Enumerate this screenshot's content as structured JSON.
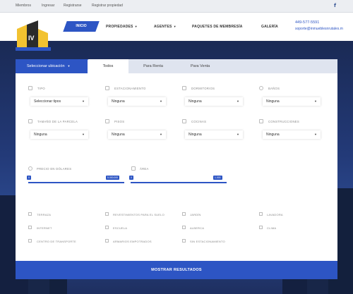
{
  "topbar": {
    "links": [
      "Miembros",
      "Ingresar",
      "Registrarse",
      "Registrar propiedad"
    ],
    "facebook_icon": "facebook-icon"
  },
  "header": {
    "nav": {
      "home": "INICIO",
      "properties": "PROPIEDADES",
      "agents": "AGENTES",
      "membership": "PAQUETES DE MEMBRESÍA",
      "gallery": "GALERÍA"
    },
    "phone": "449-577-5591",
    "email": "soporte@inmueblesnrutales.m"
  },
  "search": {
    "tabs": {
      "select_location": "Seleccionar ubicación",
      "all": "Todos",
      "rent": "Para Renta",
      "sale": "Para Venta"
    },
    "fields": [
      {
        "label": "TIPO",
        "value": "Seleccionar tipos"
      },
      {
        "label": "ESTACIONAMIENTO",
        "value": "Ninguna"
      },
      {
        "label": "DORMITORIOS",
        "value": "Ninguna"
      },
      {
        "label": "BAÑOS",
        "value": "Ninguna"
      },
      {
        "label": "TAMAÑO DE LA PARCELA",
        "value": "Ninguna"
      },
      {
        "label": "PISOS",
        "value": "Ninguna"
      },
      {
        "label": "COCINAS",
        "value": "Ninguna"
      },
      {
        "label": "CONSTRUCCIONES",
        "value": "Ninguna"
      }
    ],
    "ranges": [
      {
        "label": "PRECIO EN DÓLARES",
        "min": "0",
        "max": "5.000.000",
        "fraction": 1.0
      },
      {
        "label": "ÁREA",
        "min": "0",
        "max": "1.000",
        "fraction": 1.0
      }
    ],
    "amenities": [
      "TERRAZA",
      "REVESTIMIENTOS PARA EL SUELO",
      "JARDÍN",
      "LAVADORA",
      "INTERNET",
      "ESCUELA",
      "ALBERCA",
      "CLIMA",
      "CENTRO DE TRANSPORTE",
      "ARMARIOS EMPOTRADOS",
      "SIN ESTACIONAMIENTO"
    ],
    "submit": "MOSTRAR RESULTADOS"
  },
  "colors": {
    "accent": "#2d55c4",
    "topbar": "#eceef2"
  }
}
